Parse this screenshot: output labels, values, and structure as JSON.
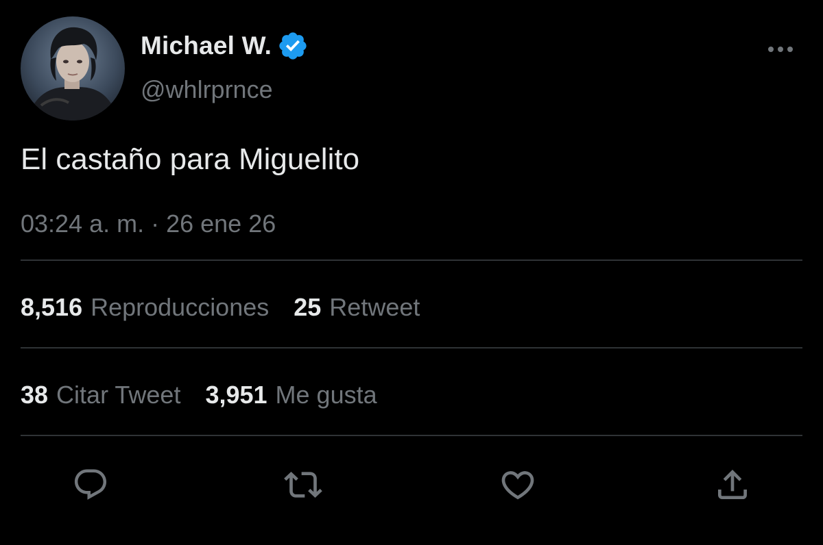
{
  "author": {
    "display_name": "Michael W.",
    "handle": "@whlrprnce",
    "verified": true,
    "verified_color": "#1d9bf0",
    "avatar_icon": "profile-photo"
  },
  "more_icon": "more-horizontal-icon",
  "tweet": {
    "text": "El castaño para Miguelito",
    "timestamp": "03:24 a. m. · 26 ene 26"
  },
  "stats": {
    "views": {
      "count": "8,516",
      "label": "Reproducciones"
    },
    "retweets": {
      "count": "25",
      "label": "Retweet"
    },
    "quotes": {
      "count": "38",
      "label": "Citar Tweet"
    },
    "likes": {
      "count": "3,951",
      "label": "Me gusta"
    }
  },
  "actions": [
    {
      "name": "reply",
      "icon": "reply-icon"
    },
    {
      "name": "retweet",
      "icon": "retweet-icon"
    },
    {
      "name": "like",
      "icon": "heart-icon"
    },
    {
      "name": "share",
      "icon": "share-icon"
    }
  ],
  "colors": {
    "background": "#000000",
    "primary_text": "#e7e9ea",
    "secondary_text": "#71767b",
    "divider": "#2f3336"
  }
}
